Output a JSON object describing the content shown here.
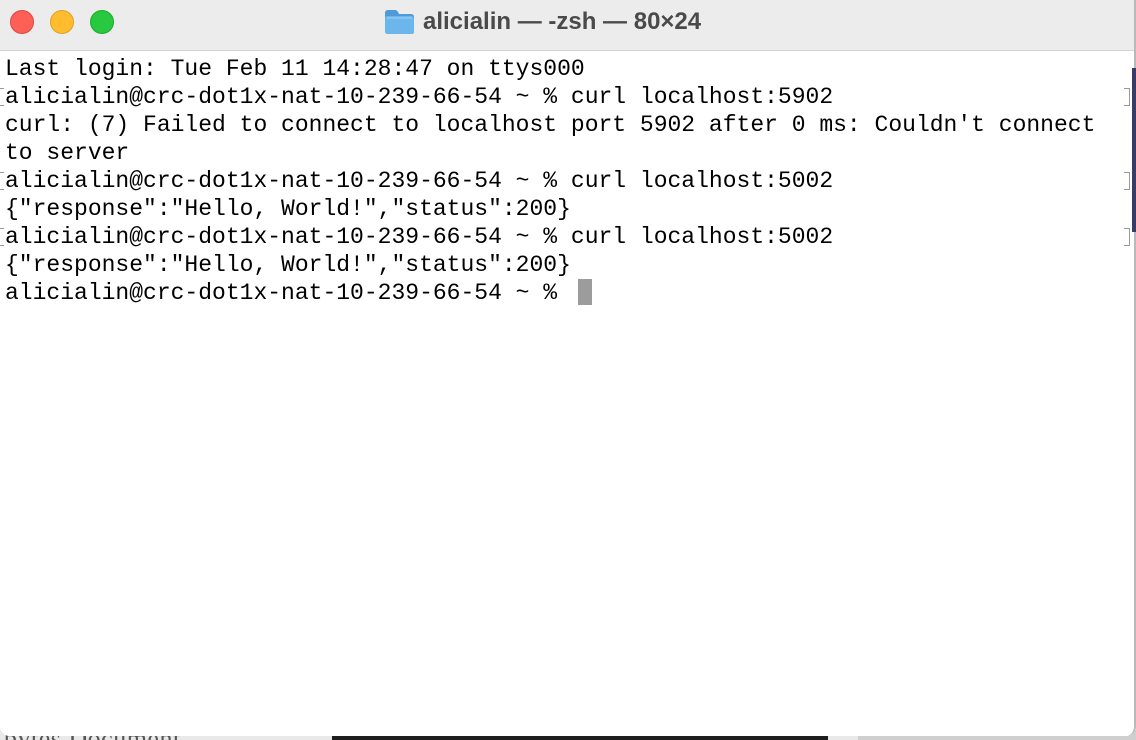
{
  "window": {
    "title": "alicialin — -zsh — 80×24",
    "folder_icon": "folder-icon",
    "controls": [
      "close",
      "minimize",
      "zoom"
    ]
  },
  "terminal": {
    "lines": [
      "Last login: Tue Feb 11 14:28:47 on ttys000",
      "alicialin@crc-dot1x-nat-10-239-66-54 ~ % curl localhost:5902",
      "curl: (7) Failed to connect to localhost port 5902 after 0 ms: Couldn't connect",
      "to server",
      "alicialin@crc-dot1x-nat-10-239-66-54 ~ % curl localhost:5002",
      "{\"response\":\"Hello, World!\",\"status\":200}",
      "alicialin@crc-dot1x-nat-10-239-66-54 ~ % curl localhost:5002",
      "{\"response\":\"Hello, World!\",\"status\":200}",
      "alicialin@crc-dot1x-nat-10-239-66-54 ~ % "
    ]
  },
  "background": {
    "ghost_text": "bytes   Document"
  },
  "colors": {
    "close": "#fe5f57",
    "minimize": "#febc2e",
    "zoom": "#28c840",
    "folder": "#5ba8e0",
    "cursor": "#9c9c9c"
  }
}
